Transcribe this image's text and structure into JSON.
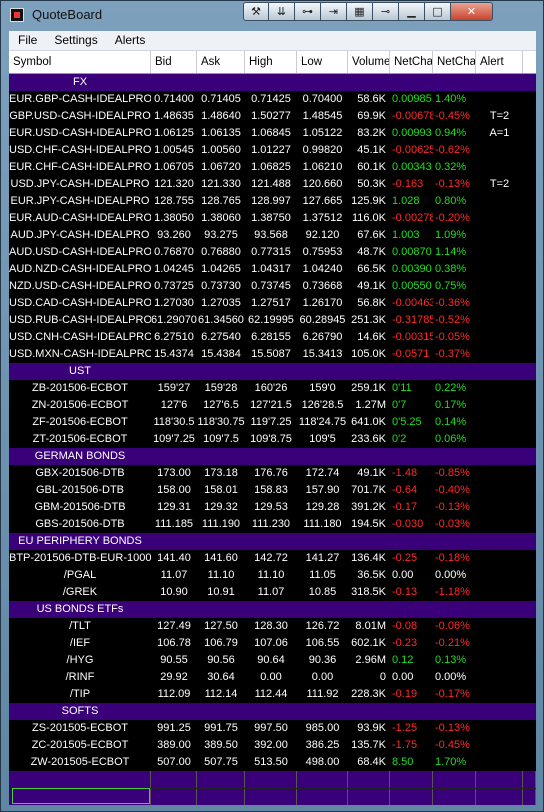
{
  "window": {
    "title": "QuoteBoard",
    "close_label": "✕"
  },
  "toolbar_icons": [
    "wrench-icon",
    "collapse-icon",
    "plug-icon",
    "export-icon",
    "grid-icon",
    "pin-icon",
    "minimize-icon",
    "maximize-icon",
    "close-icon"
  ],
  "menu": [
    "File",
    "Settings",
    "Alerts"
  ],
  "columns": [
    "Symbol",
    "Bid",
    "Ask",
    "High",
    "Low",
    "Volume",
    "NetCha",
    "NetCha",
    "Alert"
  ],
  "rows": [
    {
      "section": "FX"
    },
    {
      "sym": "EUR.GBP-CASH-IDEALPRO",
      "bid": "0.71400",
      "ask": "0.71405",
      "high": "0.71425",
      "low": "0.70400",
      "vol": "58.6K",
      "nc1": "0.00985",
      "nc2": "1.40%",
      "alert": "",
      "dir": "pos"
    },
    {
      "sym": "GBP.USD-CASH-IDEALPRO",
      "bid": "1.48635",
      "ask": "1.48640",
      "high": "1.50277",
      "low": "1.48545",
      "vol": "69.9K",
      "nc1": "-0.00678",
      "nc2": "-0.45%",
      "alert": "T=2",
      "dir": "neg"
    },
    {
      "sym": "EUR.USD-CASH-IDEALPRO",
      "bid": "1.06125",
      "ask": "1.06135",
      "high": "1.06845",
      "low": "1.05122",
      "vol": "83.2K",
      "nc1": "0.00993",
      "nc2": "0.94%",
      "alert": "A=1",
      "dir": "pos"
    },
    {
      "sym": "USD.CHF-CASH-IDEALPRO",
      "bid": "1.00545",
      "ask": "1.00560",
      "high": "1.01227",
      "low": "0.99820",
      "vol": "45.1K",
      "nc1": "-0.00625",
      "nc2": "-0.62%",
      "alert": "",
      "dir": "neg"
    },
    {
      "sym": "EUR.CHF-CASH-IDEALPRO",
      "bid": "1.06705",
      "ask": "1.06720",
      "high": "1.06825",
      "low": "1.06210",
      "vol": "60.1K",
      "nc1": "0.00343",
      "nc2": "0.32%",
      "alert": "",
      "dir": "pos"
    },
    {
      "sym": "USD.JPY-CASH-IDEALPRO",
      "bid": "121.320",
      "ask": "121.330",
      "high": "121.488",
      "low": "120.660",
      "vol": "50.3K",
      "nc1": "-0.163",
      "nc2": "-0.13%",
      "alert": "T=2",
      "dir": "neg"
    },
    {
      "sym": "EUR.JPY-CASH-IDEALPRO",
      "bid": "128.755",
      "ask": "128.765",
      "high": "128.997",
      "low": "127.665",
      "vol": "125.9K",
      "nc1": "1.028",
      "nc2": "0.80%",
      "alert": "",
      "dir": "pos"
    },
    {
      "sym": "EUR.AUD-CASH-IDEALPRO",
      "bid": "1.38050",
      "ask": "1.38060",
      "high": "1.38750",
      "low": "1.37512",
      "vol": "116.0K",
      "nc1": "-0.00278",
      "nc2": "-0.20%",
      "alert": "",
      "dir": "neg"
    },
    {
      "sym": "AUD.JPY-CASH-IDEALPRO",
      "bid": "93.260",
      "ask": "93.275",
      "high": "93.568",
      "low": "92.120",
      "vol": "67.6K",
      "nc1": "1.003",
      "nc2": "1.09%",
      "alert": "",
      "dir": "pos"
    },
    {
      "sym": "AUD.USD-CASH-IDEALPRO",
      "bid": "0.76870",
      "ask": "0.76880",
      "high": "0.77315",
      "low": "0.75953",
      "vol": "48.7K",
      "nc1": "0.00870",
      "nc2": "1.14%",
      "alert": "",
      "dir": "pos"
    },
    {
      "sym": "AUD.NZD-CASH-IDEALPRO",
      "bid": "1.04245",
      "ask": "1.04265",
      "high": "1.04317",
      "low": "1.04240",
      "vol": "66.5K",
      "nc1": "0.00390",
      "nc2": "0.38%",
      "alert": "",
      "dir": "pos"
    },
    {
      "sym": "NZD.USD-CASH-IDEALPRO",
      "bid": "0.73725",
      "ask": "0.73730",
      "high": "0.73745",
      "low": "0.73668",
      "vol": "49.1K",
      "nc1": "0.00550",
      "nc2": "0.75%",
      "alert": "",
      "dir": "pos"
    },
    {
      "sym": "USD.CAD-CASH-IDEALPRO",
      "bid": "1.27030",
      "ask": "1.27035",
      "high": "1.27517",
      "low": "1.26170",
      "vol": "56.8K",
      "nc1": "-0.00463",
      "nc2": "-0.36%",
      "alert": "",
      "dir": "neg"
    },
    {
      "sym": "USD.RUB-CASH-IDEALPRO",
      "bid": "61.29070",
      "ask": "61.34560",
      "high": "62.19995",
      "low": "60.28945",
      "vol": "251.3K",
      "nc1": "-0.31785",
      "nc2": "-0.52%",
      "alert": "",
      "dir": "neg"
    },
    {
      "sym": "USD.CNH-CASH-IDEALPRO",
      "bid": "6.27510",
      "ask": "6.27540",
      "high": "6.28155",
      "low": "6.26790",
      "vol": "14.6K",
      "nc1": "-0.00315",
      "nc2": "-0.05%",
      "alert": "",
      "dir": "neg"
    },
    {
      "sym": "USD.MXN-CASH-IDEALPRO",
      "bid": "15.4374",
      "ask": "15.4384",
      "high": "15.5087",
      "low": "15.3413",
      "vol": "105.0K",
      "nc1": "-0.0571",
      "nc2": "-0.37%",
      "alert": "",
      "dir": "neg"
    },
    {
      "section": "UST"
    },
    {
      "sym": "ZB-201506-ECBOT",
      "bid": "159'27",
      "ask": "159'28",
      "high": "160'26",
      "low": "159'0",
      "vol": "259.1K",
      "nc1": "0'11",
      "nc2": "0.22%",
      "alert": "",
      "dir": "pos"
    },
    {
      "sym": "ZN-201506-ECBOT",
      "bid": "127'6",
      "ask": "127'6.5",
      "high": "127'21.5",
      "low": "126'28.5",
      "vol": "1.27M",
      "nc1": "0'7",
      "nc2": "0.17%",
      "alert": "",
      "dir": "pos"
    },
    {
      "sym": "ZF-201506-ECBOT",
      "bid": "118'30.5",
      "ask": "118'30.75",
      "high": "119'7.25",
      "low": "118'24.75",
      "vol": "641.0K",
      "nc1": "0'5.25",
      "nc2": "0.14%",
      "alert": "",
      "dir": "pos"
    },
    {
      "sym": "ZT-201506-ECBOT",
      "bid": "109'7.25",
      "ask": "109'7.5",
      "high": "109'8.75",
      "low": "109'5",
      "vol": "233.6K",
      "nc1": "0'2",
      "nc2": "0.06%",
      "alert": "",
      "dir": "pos"
    },
    {
      "section": "GERMAN BONDS"
    },
    {
      "sym": "GBX-201506-DTB",
      "bid": "173.00",
      "ask": "173.18",
      "high": "176.76",
      "low": "172.74",
      "vol": "49.1K",
      "nc1": "-1.48",
      "nc2": "-0.85%",
      "alert": "",
      "dir": "neg"
    },
    {
      "sym": "GBL-201506-DTB",
      "bid": "158.00",
      "ask": "158.01",
      "high": "158.83",
      "low": "157.90",
      "vol": "701.7K",
      "nc1": "-0.64",
      "nc2": "-0.40%",
      "alert": "",
      "dir": "neg"
    },
    {
      "sym": "GBM-201506-DTB",
      "bid": "129.31",
      "ask": "129.32",
      "high": "129.53",
      "low": "129.28",
      "vol": "391.2K",
      "nc1": "-0.17",
      "nc2": "-0.13%",
      "alert": "",
      "dir": "neg"
    },
    {
      "sym": "GBS-201506-DTB",
      "bid": "111.185",
      "ask": "111.190",
      "high": "111.230",
      "low": "111.180",
      "vol": "194.5K",
      "nc1": "-0.030",
      "nc2": "-0.03%",
      "alert": "",
      "dir": "neg"
    },
    {
      "section": "EU PERIPHERY BONDS"
    },
    {
      "sym": "BTP-201506-DTB-EUR-1000",
      "bid": "141.40",
      "ask": "141.60",
      "high": "142.72",
      "low": "141.27",
      "vol": "136.4K",
      "nc1": "-0.25",
      "nc2": "-0.18%",
      "alert": "",
      "dir": "neg"
    },
    {
      "sym": "/PGAL",
      "bid": "11.07",
      "ask": "11.10",
      "high": "11.10",
      "low": "11.05",
      "vol": "36.5K",
      "nc1": "0.00",
      "nc2": "0.00%",
      "alert": "",
      "dir": "zero"
    },
    {
      "sym": "/GREK",
      "bid": "10.90",
      "ask": "10.91",
      "high": "11.07",
      "low": "10.85",
      "vol": "318.5K",
      "nc1": "-0.13",
      "nc2": "-1.18%",
      "alert": "",
      "dir": "neg"
    },
    {
      "section": "US BONDS ETFs"
    },
    {
      "sym": "/TLT",
      "bid": "127.49",
      "ask": "127.50",
      "high": "128.30",
      "low": "126.72",
      "vol": "8.01M",
      "nc1": "-0.08",
      "nc2": "-0.06%",
      "alert": "",
      "dir": "neg"
    },
    {
      "sym": "/IEF",
      "bid": "106.78",
      "ask": "106.79",
      "high": "107.06",
      "low": "106.55",
      "vol": "602.1K",
      "nc1": "-0.23",
      "nc2": "-0.21%",
      "alert": "",
      "dir": "neg"
    },
    {
      "sym": "/HYG",
      "bid": "90.55",
      "ask": "90.56",
      "high": "90.64",
      "low": "90.36",
      "vol": "2.96M",
      "nc1": "0.12",
      "nc2": "0.13%",
      "alert": "",
      "dir": "pos"
    },
    {
      "sym": "/RINF",
      "bid": "29.92",
      "ask": "30.64",
      "high": "0.00",
      "low": "0.00",
      "vol": "0",
      "nc1": "0.00",
      "nc2": "0.00%",
      "alert": "",
      "dir": "zero"
    },
    {
      "sym": "/TIP",
      "bid": "112.09",
      "ask": "112.14",
      "high": "112.44",
      "low": "111.92",
      "vol": "228.3K",
      "nc1": "-0.19",
      "nc2": "-0.17%",
      "alert": "",
      "dir": "neg"
    },
    {
      "section": "SOFTS"
    },
    {
      "sym": "ZS-201505-ECBOT",
      "bid": "991.25",
      "ask": "991.75",
      "high": "997.50",
      "low": "985.00",
      "vol": "93.9K",
      "nc1": "-1.25",
      "nc2": "-0.13%",
      "alert": "",
      "dir": "neg"
    },
    {
      "sym": "ZC-201505-ECBOT",
      "bid": "389.00",
      "ask": "389.50",
      "high": "392.00",
      "low": "386.25",
      "vol": "135.7K",
      "nc1": "-1.75",
      "nc2": "-0.45%",
      "alert": "",
      "dir": "neg"
    },
    {
      "sym": "ZW-201505-ECBOT",
      "bid": "507.00",
      "ask": "507.75",
      "high": "513.50",
      "low": "498.00",
      "vol": "68.4K",
      "nc1": "8.50",
      "nc2": "1.70%",
      "alert": "",
      "dir": "pos"
    }
  ],
  "colors": {
    "section_bg": "#3a007a",
    "positive": "#22dd22",
    "negative": "#ff2a2a"
  }
}
